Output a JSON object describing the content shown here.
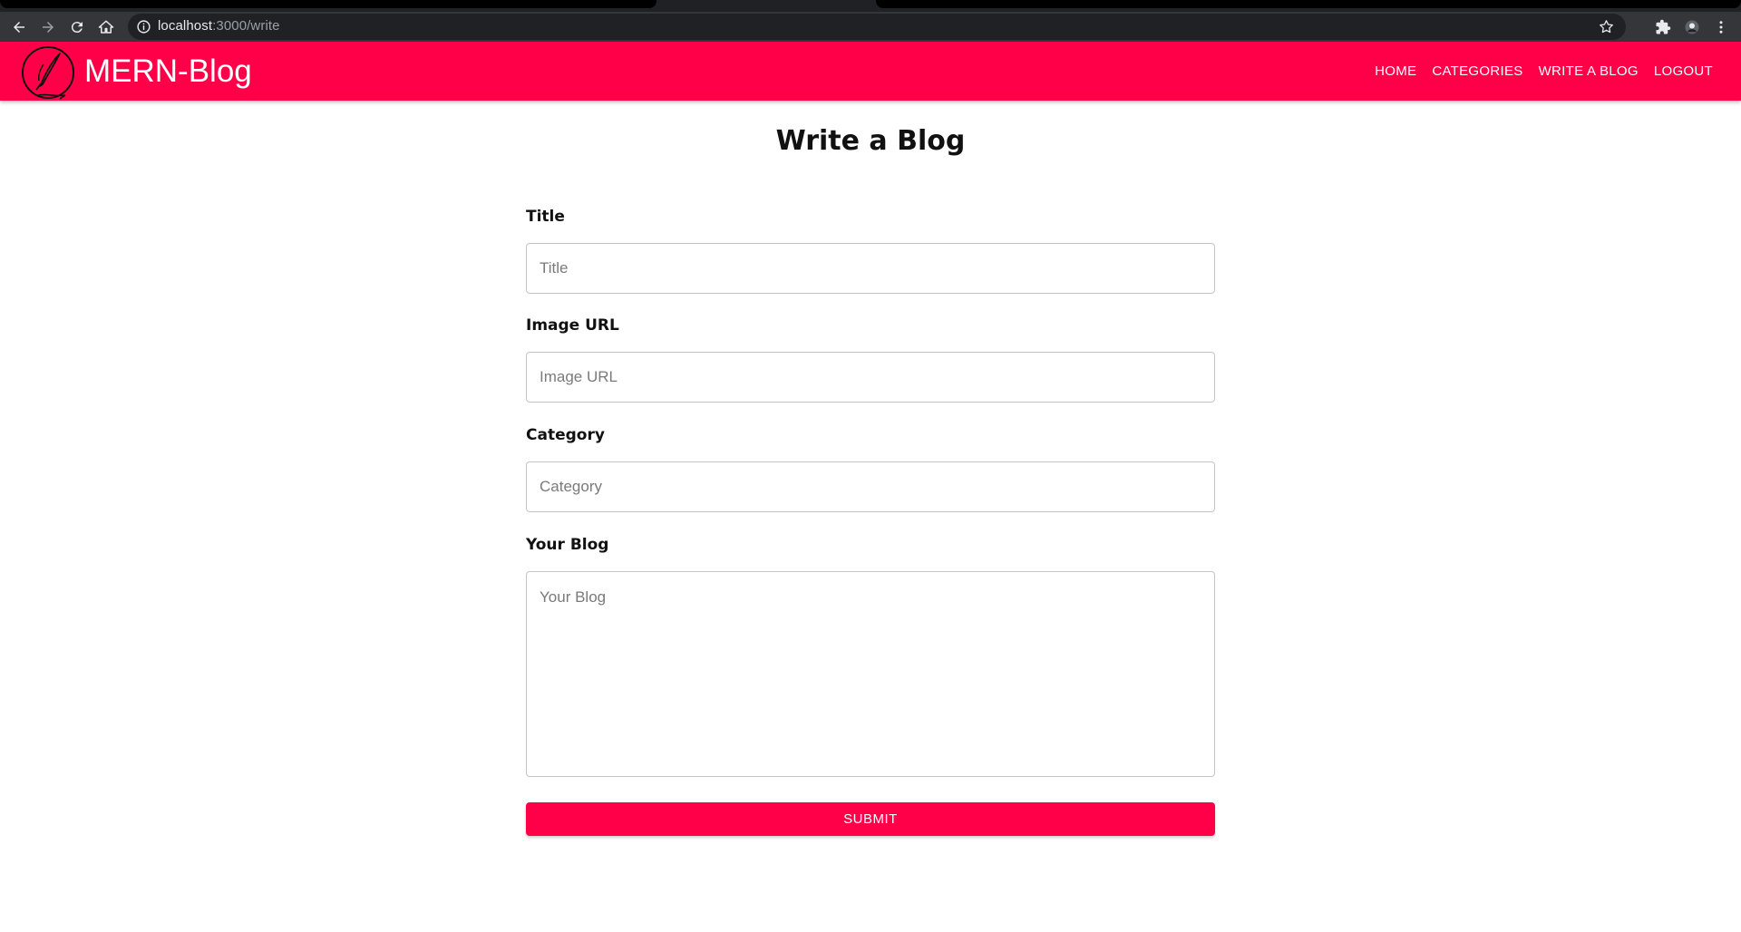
{
  "browser": {
    "url_host": "localhost",
    "url_path": ":3000/write",
    "icons": [
      "back-icon",
      "forward-icon",
      "reload-icon",
      "home-icon",
      "info-icon",
      "star-icon",
      "extensions-icon",
      "profile-icon",
      "menu-icon"
    ]
  },
  "navbar": {
    "brand": "MERN-Blog",
    "background": "#ff0048",
    "links": [
      "HOME",
      "CATEGORIES",
      "WRITE A BLOG",
      "LOGOUT"
    ]
  },
  "page": {
    "title": "Write a Blog"
  },
  "form": {
    "title": {
      "label": "Title",
      "placeholder": "Title",
      "value": ""
    },
    "image_url": {
      "label": "Image URL",
      "placeholder": "Image URL",
      "value": ""
    },
    "category": {
      "label": "Category",
      "placeholder": "Category",
      "value": ""
    },
    "blog": {
      "label": "Your Blog",
      "placeholder": "Your Blog",
      "value": ""
    },
    "submit_label": "SUBMIT"
  }
}
